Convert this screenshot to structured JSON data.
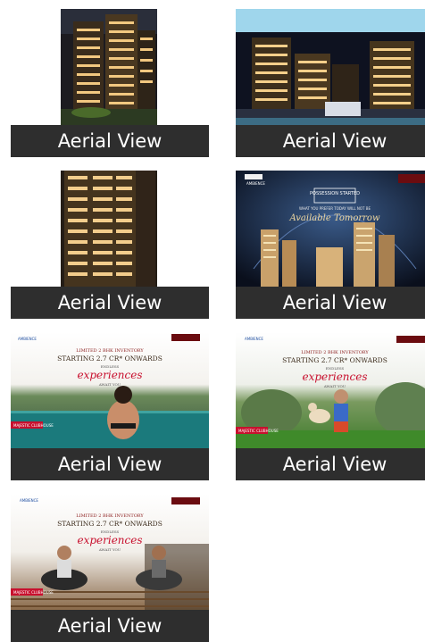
{
  "gallery": {
    "items": [
      {
        "caption": "Aerial View",
        "image": "building-night-tall"
      },
      {
        "caption": "Aerial View",
        "image": "building-night-wide"
      },
      {
        "caption": "Aerial View",
        "image": "building-night-closeup"
      },
      {
        "caption": "Aerial View",
        "image": "possession-poster",
        "poster": {
          "brand": "AMBIENCE",
          "headline": "POSSESSION STARTED",
          "line": "WHAT YOU PREFER TODAY WILL NOT BE",
          "script": "Available Tomorrow"
        }
      },
      {
        "caption": "Aerial View",
        "image": "pool-poster",
        "poster": {
          "brand": "AMBIENCE",
          "line1": "LIMITED 2 BHK INVENTORY",
          "line2": "STARTING 2.7 CR* ONWARDS",
          "line3": "ENDLESS",
          "script": "experiences",
          "line4": "AWAIT YOU",
          "tag": "MAJESTIC CLUBHOUSE"
        }
      },
      {
        "caption": "Aerial View",
        "image": "family-poster",
        "poster": {
          "brand": "AMBIENCE",
          "line1": "LIMITED 2 BHK INVENTORY",
          "line2": "STARTING 2.7 CR* ONWARDS",
          "line3": "ENDLESS",
          "script": "experiences",
          "line4": "AWAIT YOU",
          "tag": "MAJESTIC CLUBHOUSE"
        }
      },
      {
        "caption": "Aerial View",
        "image": "yoga-poster",
        "poster": {
          "brand": "AMBIENCE",
          "line1": "LIMITED 2 BHK INVENTORY",
          "line2": "STARTING 2.7 CR* ONWARDS",
          "line3": "ENDLESS",
          "script": "experiences",
          "line4": "AWAIT YOU",
          "tag": "MAJESTIC CLUBHOUSE"
        }
      }
    ]
  },
  "colors": {
    "caption_bg": "#2e2e2e",
    "caption_text": "#ffffff",
    "accent_red": "#c8102e"
  }
}
